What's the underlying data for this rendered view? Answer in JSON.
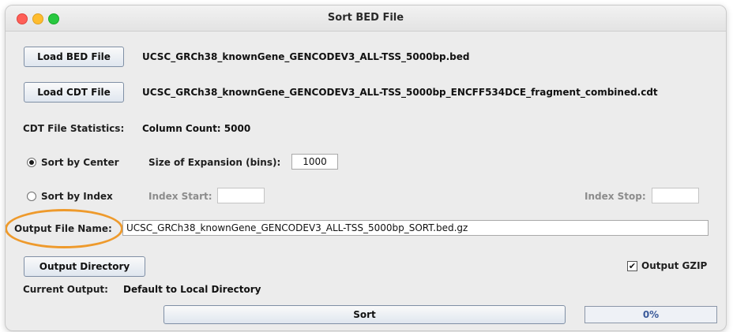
{
  "window": {
    "title": "Sort BED File"
  },
  "bed": {
    "button_label": "Load BED File",
    "file_name": "UCSC_GRCh38_knownGene_GENCODEV3_ALL-TSS_5000bp.bed"
  },
  "cdt": {
    "button_label": "Load CDT File",
    "file_name": "UCSC_GRCh38_knownGene_GENCODEV3_ALL-TSS_5000bp_ENCFF534DCE_fragment_combined.cdt"
  },
  "stats": {
    "label": "CDT File Statistics:",
    "value": "Column Count: 5000"
  },
  "sort_center": {
    "label": "Sort by Center",
    "selected": true,
    "expansion_label": "Size of Expansion (bins):",
    "expansion_value": "1000"
  },
  "sort_index": {
    "label": "Sort by Index",
    "selected": false,
    "start_label": "Index Start:",
    "start_value": "",
    "stop_label": "Index Stop:",
    "stop_value": ""
  },
  "output": {
    "file_name_label": "Output File Name:",
    "file_name_value": "UCSC_GRCh38_knownGene_GENCODEV3_ALL-TSS_5000bp_SORT.bed.gz",
    "directory_button": "Output Directory",
    "gzip_label": "Output GZIP",
    "gzip_checked": true,
    "current_label": "Current Output:",
    "current_value": "Default to Local Directory"
  },
  "sort_button": {
    "label": "Sort"
  },
  "progress": {
    "value": 0,
    "label": "0%"
  },
  "colors": {
    "highlight": "#ee9a2c",
    "close": "#fe5f57",
    "minimize": "#febc2e",
    "maximize": "#28c840"
  }
}
